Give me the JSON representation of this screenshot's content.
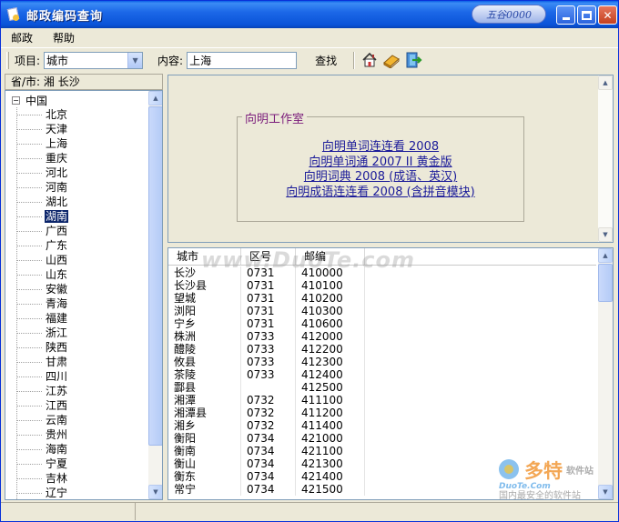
{
  "window": {
    "title": "邮政编码查询",
    "badge": "五谷0000"
  },
  "menu": [
    "邮政",
    "帮助"
  ],
  "toolbar": {
    "item_label": "项目:",
    "item_value": "城市",
    "content_label": "内容:",
    "content_value": "上海",
    "find_label": "查找",
    "icons": [
      "home-icon",
      "book-icon",
      "exit-icon"
    ]
  },
  "left": {
    "header": "省/市: 湘 长沙",
    "root": "中国",
    "provinces": [
      "北京",
      "天津",
      "上海",
      "重庆",
      "河北",
      "河南",
      "湖北",
      "湖南",
      "广西",
      "广东",
      "山西",
      "山东",
      "安徽",
      "青海",
      "福建",
      "浙江",
      "陕西",
      "甘肃",
      "四川",
      "江苏",
      "江西",
      "云南",
      "贵州",
      "海南",
      "宁夏",
      "吉林",
      "辽宁"
    ],
    "selected": "湖南"
  },
  "ad": {
    "title": "向明工作室",
    "links": [
      "向明单词连连看 2008",
      "向明单词通 2007 II 黄金版",
      "向明词典 2008 (成语、英汉)",
      "向明成语连连看 2008 (含拼音模块)"
    ]
  },
  "table": {
    "columns": [
      "城市",
      "区号",
      "邮编"
    ],
    "rows": [
      [
        "长沙",
        "0731",
        "410000"
      ],
      [
        "长沙县",
        "0731",
        "410100"
      ],
      [
        "望城",
        "0731",
        "410200"
      ],
      [
        "浏阳",
        "0731",
        "410300"
      ],
      [
        "宁乡",
        "0731",
        "410600"
      ],
      [
        "株洲",
        "0733",
        "412000"
      ],
      [
        "醴陵",
        "0733",
        "412200"
      ],
      [
        "攸县",
        "0733",
        "412300"
      ],
      [
        "茶陵",
        "0733",
        "412400"
      ],
      [
        "酃县",
        "",
        "412500"
      ],
      [
        "湘潭",
        "0732",
        "411100"
      ],
      [
        "湘潭县",
        "0732",
        "411200"
      ],
      [
        "湘乡",
        "0732",
        "411400"
      ],
      [
        "衡阳",
        "0734",
        "421000"
      ],
      [
        "衡南",
        "0734",
        "421100"
      ],
      [
        "衡山",
        "0734",
        "421300"
      ],
      [
        "衡东",
        "0734",
        "421400"
      ],
      [
        "常宁",
        "0734",
        "421500"
      ]
    ]
  },
  "watermarks": {
    "duote": "www.DuoTe.com",
    "logo_main": "多特",
    "logo_sub": "软件站",
    "logo_url": "DuoTe.Com",
    "logo_slogan": "国内最安全的软件站"
  },
  "colors": {
    "titlebar": "#0a53d8",
    "selection": "#0a246a",
    "link": "#1a1a99",
    "group_title": "#7b1d7b"
  }
}
